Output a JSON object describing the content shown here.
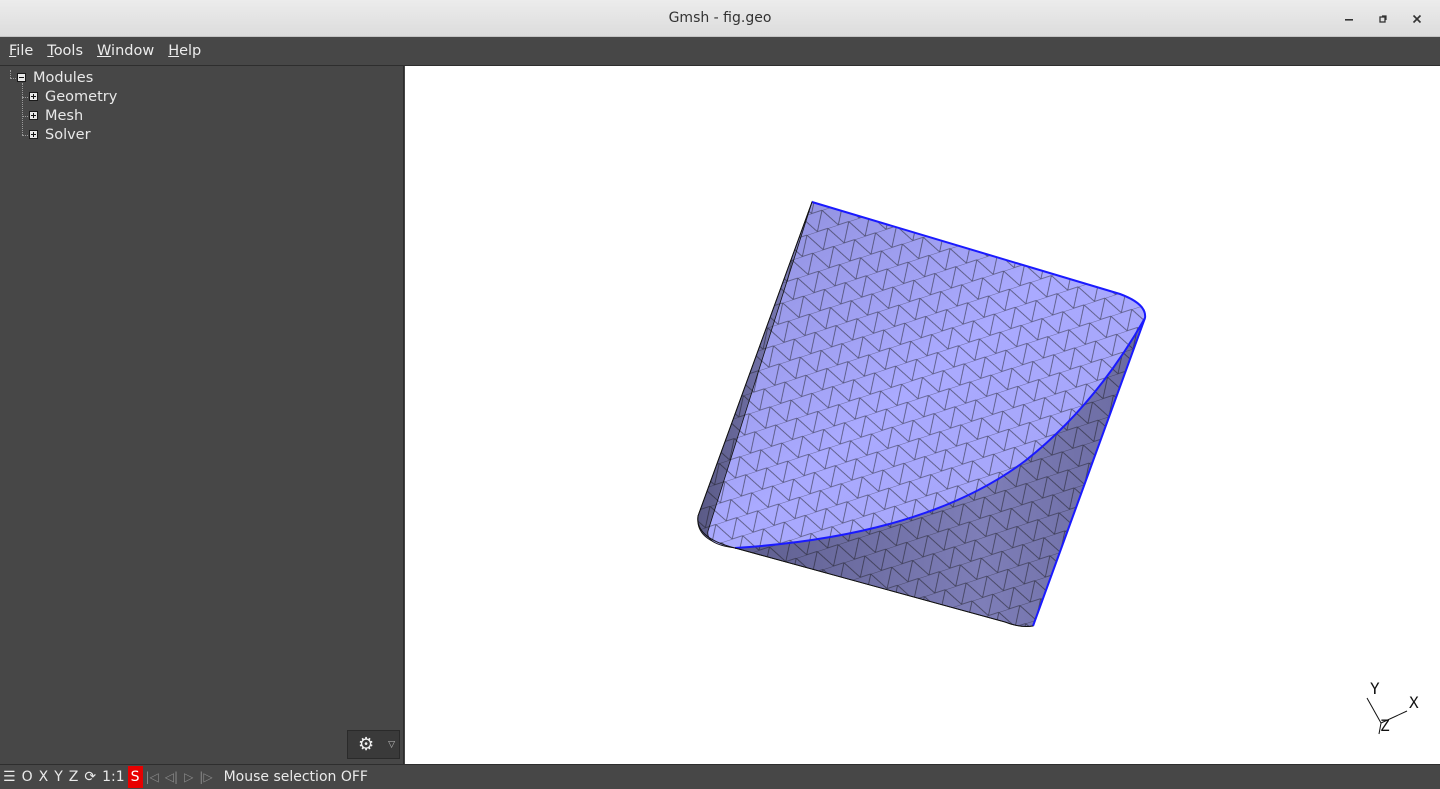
{
  "window": {
    "title": "Gmsh - fig.geo",
    "controls": [
      "minimize",
      "restore",
      "close"
    ]
  },
  "menu": [
    {
      "pre": "",
      "ul": "F",
      "post": "ile"
    },
    {
      "pre": "",
      "ul": "T",
      "post": "ools"
    },
    {
      "pre": "",
      "ul": "W",
      "post": "indow"
    },
    {
      "pre": "",
      "ul": "H",
      "post": "elp"
    }
  ],
  "tree": {
    "root": "Modules",
    "children": [
      "Geometry",
      "Mesh",
      "Solver"
    ]
  },
  "axes": {
    "y": "Y",
    "x": "X",
    "z": "Z"
  },
  "statusbar": {
    "menu_glyph": "☰",
    "o": "O",
    "x": "X",
    "y": "Y",
    "z": "Z",
    "rotate_glyph": "⟳",
    "scale": "1:1",
    "s": "S",
    "first": "|◁",
    "prev": "◁|",
    "play": "▷",
    "next": "|▷",
    "message": "Mouse selection OFF"
  },
  "colors": {
    "mesh_fill_light": "#a9a9ff",
    "mesh_fill_dark": "#6c6c9e",
    "edge_highlight": "#1a1aff",
    "status_s": "#e80000"
  }
}
